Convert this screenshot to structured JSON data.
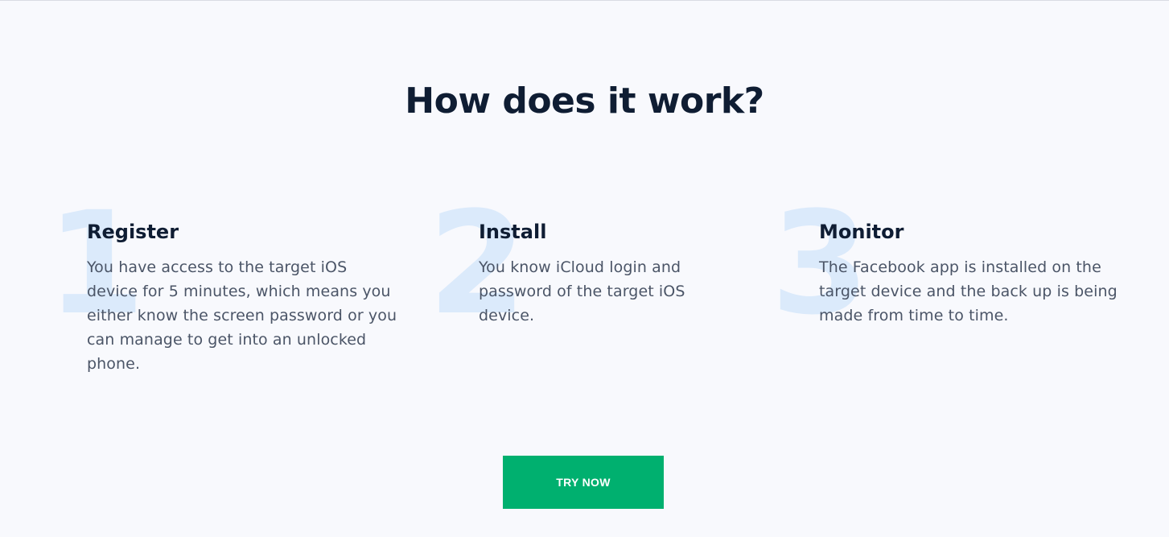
{
  "section": {
    "title": "How does it work?"
  },
  "steps": [
    {
      "number": "1",
      "title": "Register",
      "description": "You have access to the target iOS device for 5 minutes, which means you either know the screen password or you can manage to get into an unlocked phone."
    },
    {
      "number": "2",
      "title": "Install",
      "description": "You know iCloud login and password of the target iOS device."
    },
    {
      "number": "3",
      "title": "Monitor",
      "description": "The Facebook app is installed on the target device and the back up is being made from time to time."
    }
  ],
  "cta": {
    "label": "TRY NOW"
  },
  "colors": {
    "background": "#f8f9fd",
    "heading": "#0f1d33",
    "body_text": "#4b5567",
    "step_number": "#dbeafb",
    "cta_background": "#00b06f",
    "cta_text": "#ffffff"
  }
}
